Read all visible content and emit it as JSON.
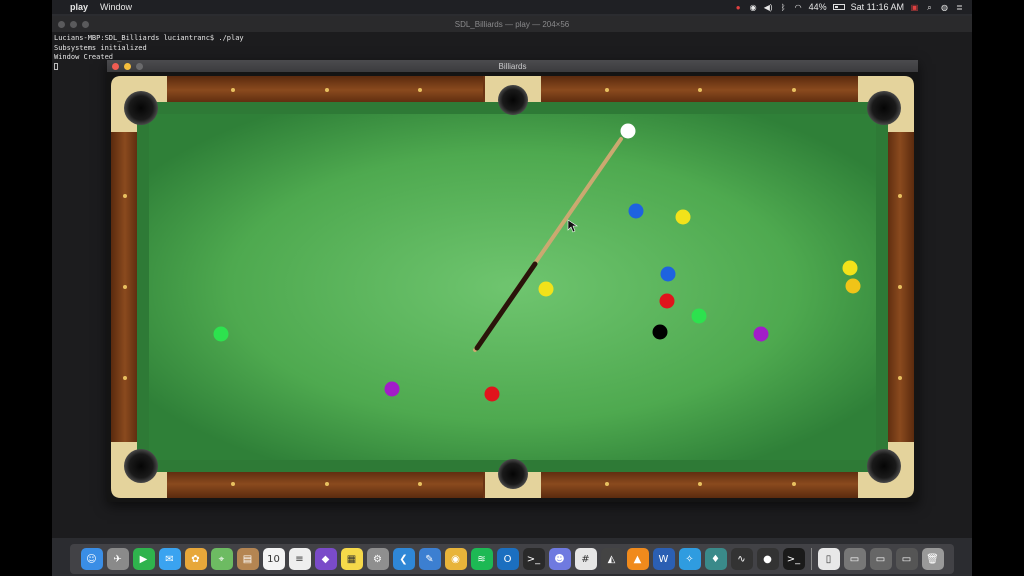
{
  "menubar": {
    "apple": "",
    "app_name": "play",
    "items": [
      "Window"
    ],
    "battery_percent": "44%",
    "battery_level": 0.44,
    "clock": "Sat 11:16 AM"
  },
  "terminal": {
    "title": "SDL_Billiards — play — 204×56",
    "lines": [
      "Lucians-MBP:SDL_Billiards luciantranc$ ./play",
      "Subsystems initialized",
      "Window Created"
    ]
  },
  "billiards_window": {
    "title": "Billiards"
  },
  "colors": {
    "felt": "#5fb35f",
    "felt_edge": "#2e7a36",
    "rail_wood": "#7a3d18",
    "corner_cream": "#e8d9a6",
    "ball_white": "#ffffff",
    "ball_blue": "#1e63e0",
    "ball_yellow": "#f2e21a",
    "ball_red": "#e0141c",
    "ball_green": "#2de24e",
    "ball_purple": "#a21dc8",
    "ball_black": "#000000",
    "ball_orange": "#f0c418"
  },
  "dock": {
    "items": [
      {
        "name": "finder-icon",
        "glyph": "☺",
        "color": "#3a8ee6"
      },
      {
        "name": "launchpad-icon",
        "glyph": "✈",
        "color": "#8a8a8a"
      },
      {
        "name": "facetime-icon",
        "glyph": "▶",
        "color": "#2fb34d"
      },
      {
        "name": "messages-icon",
        "glyph": "✉",
        "color": "#3aa3f0"
      },
      {
        "name": "photos-icon",
        "glyph": "✿",
        "color": "#e7a73a"
      },
      {
        "name": "maps-icon",
        "glyph": "⌖",
        "color": "#6dbb62"
      },
      {
        "name": "notes-brown-icon",
        "glyph": "▤",
        "color": "#b48552"
      },
      {
        "name": "calendar-icon",
        "glyph": "10",
        "color": "#f4f4f4"
      },
      {
        "name": "reminders-icon",
        "glyph": "≡",
        "color": "#eeeeee"
      },
      {
        "name": "visual-studio-icon",
        "glyph": "◆",
        "color": "#7a4bc9"
      },
      {
        "name": "notes-icon",
        "glyph": "▦",
        "color": "#f6d94a"
      },
      {
        "name": "system-preferences-icon",
        "glyph": "⚙",
        "color": "#8f8f8f"
      },
      {
        "name": "vscode-icon",
        "glyph": "❮",
        "color": "#2f87d6"
      },
      {
        "name": "xcode-icon",
        "glyph": "✎",
        "color": "#3c7fd1"
      },
      {
        "name": "chrome-icon",
        "glyph": "◉",
        "color": "#e8b43a"
      },
      {
        "name": "spotify-icon",
        "glyph": "≋",
        "color": "#1db954"
      },
      {
        "name": "outlook-icon",
        "glyph": "O",
        "color": "#1b6fc0"
      },
      {
        "name": "terminal-icon",
        "glyph": ">_",
        "color": "#2a2a2a"
      },
      {
        "name": "discord-icon",
        "glyph": "☻",
        "color": "#6f7ae0"
      },
      {
        "name": "slack-icon",
        "glyph": "#",
        "color": "#e6e6e6"
      },
      {
        "name": "unity-icon",
        "glyph": "◭",
        "color": "#444444"
      },
      {
        "name": "vlc-icon",
        "glyph": "▲",
        "color": "#f08a1c"
      },
      {
        "name": "word-icon",
        "glyph": "W",
        "color": "#2b5fb3"
      },
      {
        "name": "safari-icon",
        "glyph": "✧",
        "color": "#2f9ce0"
      },
      {
        "name": "keynote-icon",
        "glyph": "♦",
        "color": "#3a8a8a"
      },
      {
        "name": "activity-monitor-icon",
        "glyph": "∿",
        "color": "#333333"
      },
      {
        "name": "obs-icon",
        "glyph": "●",
        "color": "#333333"
      },
      {
        "name": "terminal2-icon",
        "glyph": ">_",
        "color": "#1a1a1a"
      },
      {
        "name": "document-icon",
        "glyph": "▯",
        "color": "#e8e8e8"
      },
      {
        "name": "folder-downloads-icon",
        "glyph": "▭",
        "color": "#777777"
      },
      {
        "name": "folder-icon",
        "glyph": "▭",
        "color": "#666666"
      },
      {
        "name": "finder-window-icon",
        "glyph": "▭",
        "color": "#555555"
      },
      {
        "name": "trash-icon",
        "glyph": "🗑",
        "color": "#999999"
      }
    ]
  },
  "game": {
    "balls": [
      {
        "name": "cue-ball",
        "color": "#ffffff"
      },
      {
        "name": "ball-blue-1",
        "color": "#1e63e0"
      },
      {
        "name": "ball-yellow-1",
        "color": "#f2e21a"
      },
      {
        "name": "ball-blue-2",
        "color": "#1e63e0"
      },
      {
        "name": "ball-yellow-2",
        "color": "#f2e21a"
      },
      {
        "name": "ball-yellow-3",
        "color": "#f2e21a"
      },
      {
        "name": "ball-orange-1",
        "color": "#f0c418"
      },
      {
        "name": "ball-red-1",
        "color": "#e0141c"
      },
      {
        "name": "ball-green-1",
        "color": "#2de24e"
      },
      {
        "name": "ball-black-8",
        "color": "#000000"
      },
      {
        "name": "ball-purple-1",
        "color": "#a21dc8"
      },
      {
        "name": "ball-green-2",
        "color": "#2de24e"
      },
      {
        "name": "ball-purple-2",
        "color": "#a21dc8"
      },
      {
        "name": "ball-red-2",
        "color": "#e0141c"
      }
    ]
  }
}
